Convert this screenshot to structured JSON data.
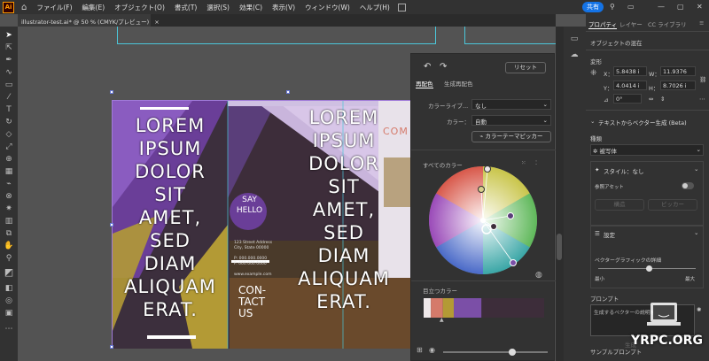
{
  "menubar": {
    "logo": "Ai",
    "items": [
      "ファイル(F)",
      "編集(E)",
      "オブジェクト(O)",
      "書式(T)",
      "選択(S)",
      "効果(C)",
      "表示(V)",
      "ウィンドウ(W)",
      "ヘルプ(H)"
    ],
    "share": "共有"
  },
  "document": {
    "tab": "illustrator-test.ai* @ 50 % (CMYK/プレビュー)",
    "close": "×"
  },
  "artwork": {
    "left_heading": [
      "LOREM",
      "IPSUM",
      "DOLOR",
      "SIT",
      "AMET,",
      "SED",
      "DIAM",
      "ALIQUAM",
      "ERAT."
    ],
    "right_heading": [
      "LOREM",
      "IPSUM",
      "DOLOR",
      "SIT",
      "AMET,",
      "SED",
      "DIAM",
      "ALIQUAM",
      "ERAT."
    ],
    "say_hello": [
      "SAY",
      "HELLO"
    ],
    "address": [
      "123 Street Address",
      "City, State 00000"
    ],
    "phone": [
      "P: 000.000.0000",
      "F: 000.000.0000"
    ],
    "web": "www.example.com",
    "contact": [
      "CON-",
      "TACT",
      "US"
    ],
    "partial": "COM"
  },
  "recolor": {
    "reset": "リセット",
    "tab_recolor": "再配色",
    "tab_generative": "生成再配色",
    "library_label": "カラーライブ...",
    "library_value": "なし",
    "color_label": "カラー：",
    "color_value": "自動",
    "theme_picker": "カラーテーマピッカー",
    "all_colors": "すべてのカラー",
    "prominent": "目立つカラー",
    "swatches": [
      "#efe9ea",
      "#d57a6a",
      "#b39a35",
      "#7b4fa7",
      "#3d2d3a"
    ],
    "swatch_widths": [
      0.06,
      0.1,
      0.09,
      0.23,
      0.52
    ]
  },
  "properties": {
    "tabs": [
      "プロパティ",
      "レイヤー",
      "CC ライブラリ"
    ],
    "object_type": "オブジェクトの混在",
    "transform": "変形",
    "x_label": "X：",
    "x_value": "5.8438 i",
    "w_label": "W：",
    "w_value": "11.9376",
    "y_label": "Y：",
    "y_value": "4.0414 i",
    "h_label": "H：",
    "h_value": "8.7026 i",
    "angle": "0°",
    "text_to_vector": "テキストからベクター生成 (Beta)",
    "kind_label": "種類",
    "kind_value": "被写体",
    "style_label": "スタイル：なし",
    "reference_asset": "参照アセット",
    "structure": "構造",
    "picker": "ピッカー",
    "settings": "設定",
    "detail_label": "ベクターグラフィックの詳細",
    "min": "最小",
    "max": "最大",
    "prompt_label": "プロンプト",
    "prompt_placeholder": "生成するベクターの説明を入力",
    "sample": "サンプルプロンプト",
    "generate": "生成"
  },
  "watermark": "YRPC.ORG"
}
